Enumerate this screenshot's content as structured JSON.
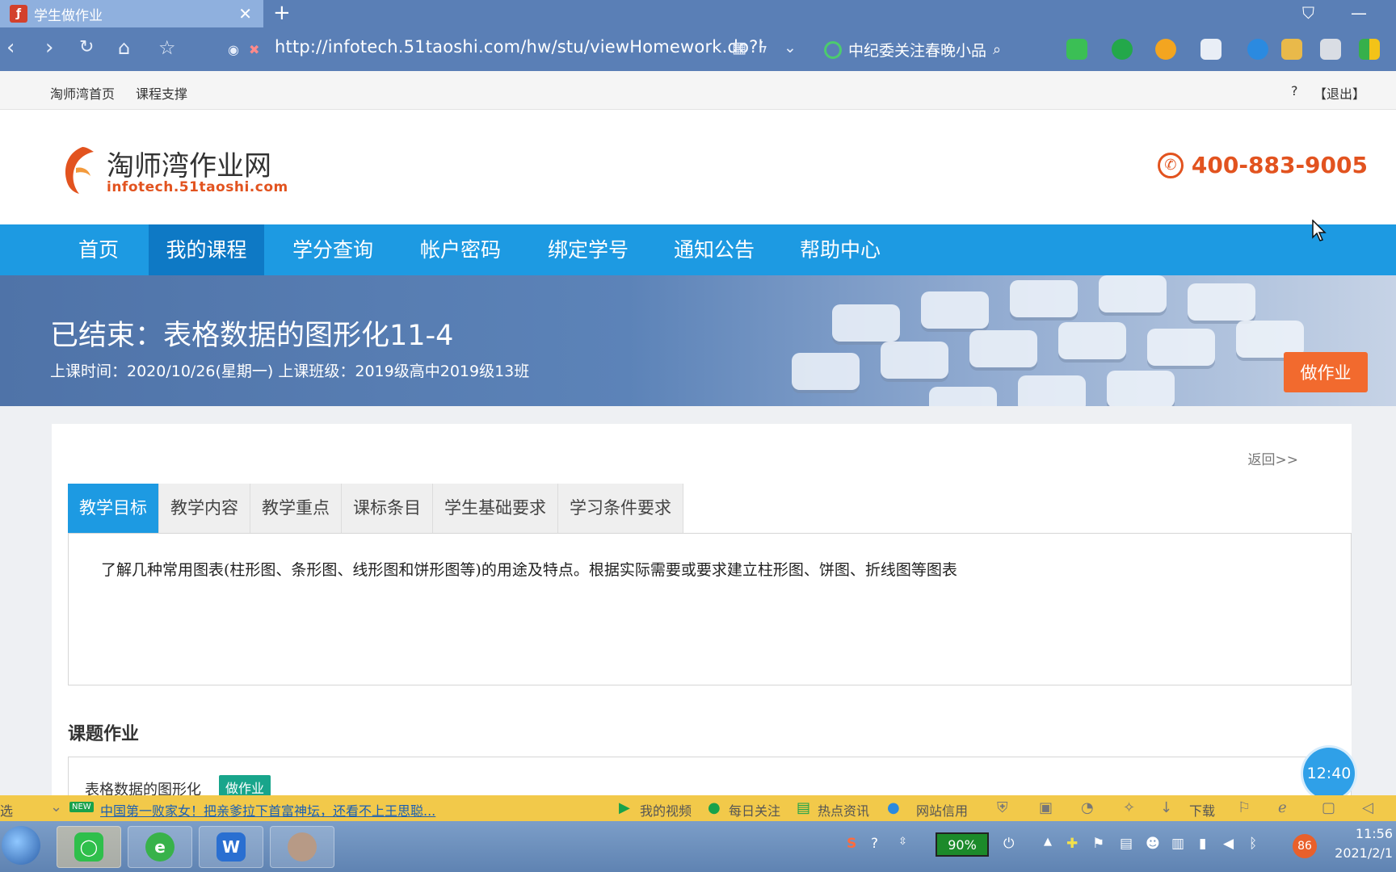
{
  "browser": {
    "tab_title": "学生做作业",
    "url": "http://infotech.51taoshi.com/hw/stu/viewHomework.do?l",
    "search_text": "中纪委关注春晚小品"
  },
  "topnav": {
    "home": "淘师湾首页",
    "support": "课程支撑",
    "help": "?",
    "logout": "【退出】"
  },
  "header": {
    "logo_cn": "淘师湾作业网",
    "logo_en": "infotech.51taoshi.com",
    "phone": "400-883-9005"
  },
  "nav": [
    "首页",
    "我的课程",
    "学分查询",
    "帐户密码",
    "绑定学号",
    "通知公告",
    "帮助中心"
  ],
  "banner": {
    "title": "已结束：表格数据的图形化11-4",
    "meta": "上课时间：2020/10/26(星期一)  上课班级：2019级高中2019级13班",
    "do_homework": "做作业"
  },
  "content": {
    "back": "返回>>",
    "tabs": [
      "教学目标",
      "教学内容",
      "教学重点",
      "课标条目",
      "学生基础要求",
      "学习条件要求"
    ],
    "tab_text": "了解几种常用图表(柱形图、条形图、线形图和饼形图等)的用途及特点。根据实际需要或要求建立柱形图、饼图、折线图等图表",
    "section_title": "课题作业",
    "task_name": "表格数据的图形化",
    "task_button": "做作业"
  },
  "timer": "12:40",
  "newsbar": {
    "left": "选",
    "new_badge": "NEW",
    "headline": "中国第一败家女！把亲爹拉下首富神坛，还看不上王思聪...",
    "my_video": "我的视频",
    "daily": "每日关注",
    "hot": "热点资讯",
    "credit": "网站信用",
    "download": "下载"
  },
  "taskbar": {
    "battery": "90%",
    "badge": "86",
    "time": "11:56",
    "date": "2021/2/1"
  }
}
